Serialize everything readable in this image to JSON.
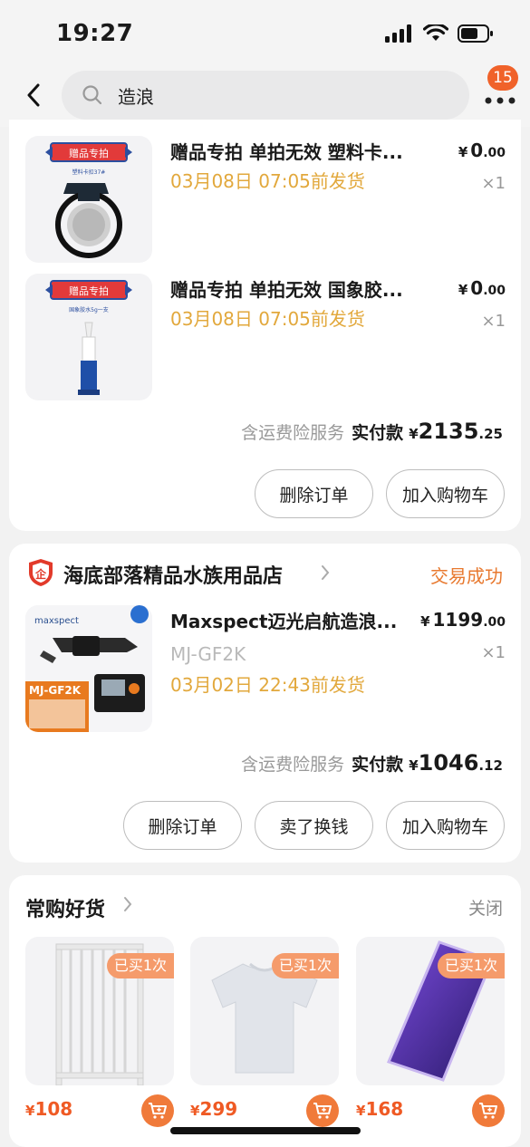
{
  "status_bar": {
    "time": "19:27"
  },
  "search": {
    "query": "造浪",
    "badge_count": "15"
  },
  "order1": {
    "items": [
      {
        "title": "赠品专拍 单拍无效 塑料卡...",
        "ship": "03月08日 07:05前发货",
        "price_cur": "¥",
        "price_int": "0",
        "price_dec": ".00",
        "qty": "×1",
        "img_banner": "赠品专拍",
        "img_caption": "塑料卡扣37#"
      },
      {
        "title": "赠品专拍 单拍无效 国象胶...",
        "ship": "03月08日 07:05前发货",
        "price_cur": "¥",
        "price_int": "0",
        "price_dec": ".00",
        "qty": "×1",
        "img_banner": "赠品专拍",
        "img_caption": "国象胶水5g一支"
      }
    ],
    "total": {
      "service": "含运费险服务",
      "label": "实付款",
      "cur": "¥",
      "int": "2135",
      "dec": ".25"
    },
    "buttons": {
      "delete": "删除订单",
      "add_cart": "加入购物车"
    }
  },
  "order2": {
    "shop_name": "海底部落精品水族用品店",
    "shop_badge": "企",
    "status": "交易成功",
    "item": {
      "title": "Maxspect迈光启航造浪...",
      "spec": "MJ-GF2K",
      "ship": "03月02日 22:43前发货",
      "price_cur": "¥",
      "price_int": "1199",
      "price_dec": ".00",
      "qty": "×1",
      "img_brand": "maxspect",
      "img_model": "MJ-GF2K"
    },
    "total": {
      "service": "含运费险服务",
      "label": "实付款",
      "cur": "¥",
      "int": "1046",
      "dec": ".12"
    },
    "buttons": {
      "delete": "删除订单",
      "sell": "卖了换钱",
      "add_cart": "加入购物车"
    }
  },
  "recommend": {
    "title": "常购好货",
    "close": "关闭",
    "items": [
      {
        "tag": "已买1次",
        "price_cur": "¥",
        "price": "108"
      },
      {
        "tag": "已买1次",
        "price_cur": "¥",
        "price": "299"
      },
      {
        "tag": "已买1次",
        "price_cur": "¥",
        "price": "168"
      }
    ]
  }
}
